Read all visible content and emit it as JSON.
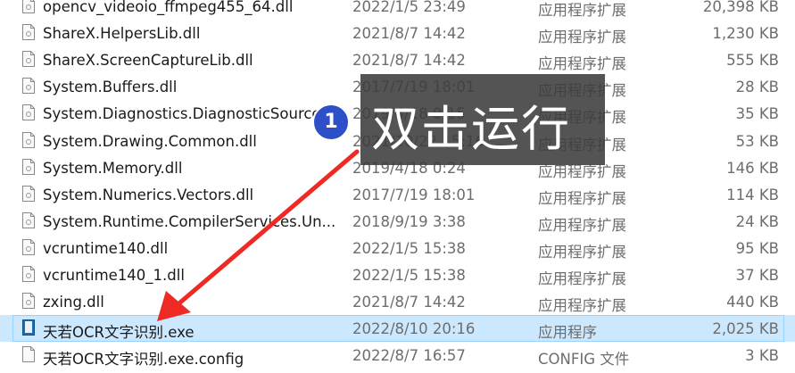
{
  "files": [
    {
      "name": "opencv_videoio_ffmpeg455_64.dll",
      "date": "2022/1/5 23:49",
      "type": "应用程序扩展",
      "size": "20,398 KB",
      "icon": "dll-icon"
    },
    {
      "name": "ShareX.HelpersLib.dll",
      "date": "2021/8/7 14:42",
      "type": "应用程序扩展",
      "size": "1,230 KB",
      "icon": "dll-icon"
    },
    {
      "name": "ShareX.ScreenCaptureLib.dll",
      "date": "2021/8/7 14:42",
      "type": "应用程序扩展",
      "size": "555 KB",
      "icon": "dll-icon"
    },
    {
      "name": "System.Buffers.dll",
      "date": "2017/7/19 18:01",
      "type": "应用程序扩展",
      "size": "28 KB",
      "icon": "dll-icon"
    },
    {
      "name": "System.Diagnostics.DiagnosticSource.dll",
      "date": "2019/4/18 0:15",
      "type": "应用程序扩展",
      "size": "35 KB",
      "icon": "dll-icon"
    },
    {
      "name": "System.Drawing.Common.dll",
      "date": "2021/10/22 15:16",
      "type": "应用程序扩展",
      "size": "53 KB",
      "icon": "dll-icon"
    },
    {
      "name": "System.Memory.dll",
      "date": "2019/4/18 0:24",
      "type": "应用程序扩展",
      "size": "146 KB",
      "icon": "dll-icon"
    },
    {
      "name": "System.Numerics.Vectors.dll",
      "date": "2017/7/19 18:01",
      "type": "应用程序扩展",
      "size": "114 KB",
      "icon": "dll-icon"
    },
    {
      "name": "System.Runtime.CompilerServices.Un...",
      "date": "2018/9/19 3:38",
      "type": "应用程序扩展",
      "size": "24 KB",
      "icon": "dll-icon"
    },
    {
      "name": "vcruntime140.dll",
      "date": "2022/1/5 15:38",
      "type": "应用程序扩展",
      "size": "95 KB",
      "icon": "dll-icon"
    },
    {
      "name": "vcruntime140_1.dll",
      "date": "2022/1/5 15:38",
      "type": "应用程序扩展",
      "size": "37 KB",
      "icon": "dll-icon"
    },
    {
      "name": "zxing.dll",
      "date": "2021/8/7 14:42",
      "type": "应用程序扩展",
      "size": "440 KB",
      "icon": "dll-icon"
    },
    {
      "name": "天若OCR文字识别.exe",
      "date": "2022/8/10 20:16",
      "type": "应用程序",
      "size": "2,025 KB",
      "icon": "exe-icon",
      "selected": true
    },
    {
      "name": "天若OCR文字识别.exe.config",
      "date": "2022/8/7 16:57",
      "type": "CONFIG 文件",
      "size": "3 KB",
      "icon": "config-file-icon"
    }
  ],
  "annotation": {
    "step": "1",
    "text": "双击运行",
    "box_color": "#3c3c3c",
    "arrow_color": "#ee2a24"
  },
  "colors": {
    "selected_bg": "#cce8ff",
    "badge": "#2d4fc7"
  }
}
